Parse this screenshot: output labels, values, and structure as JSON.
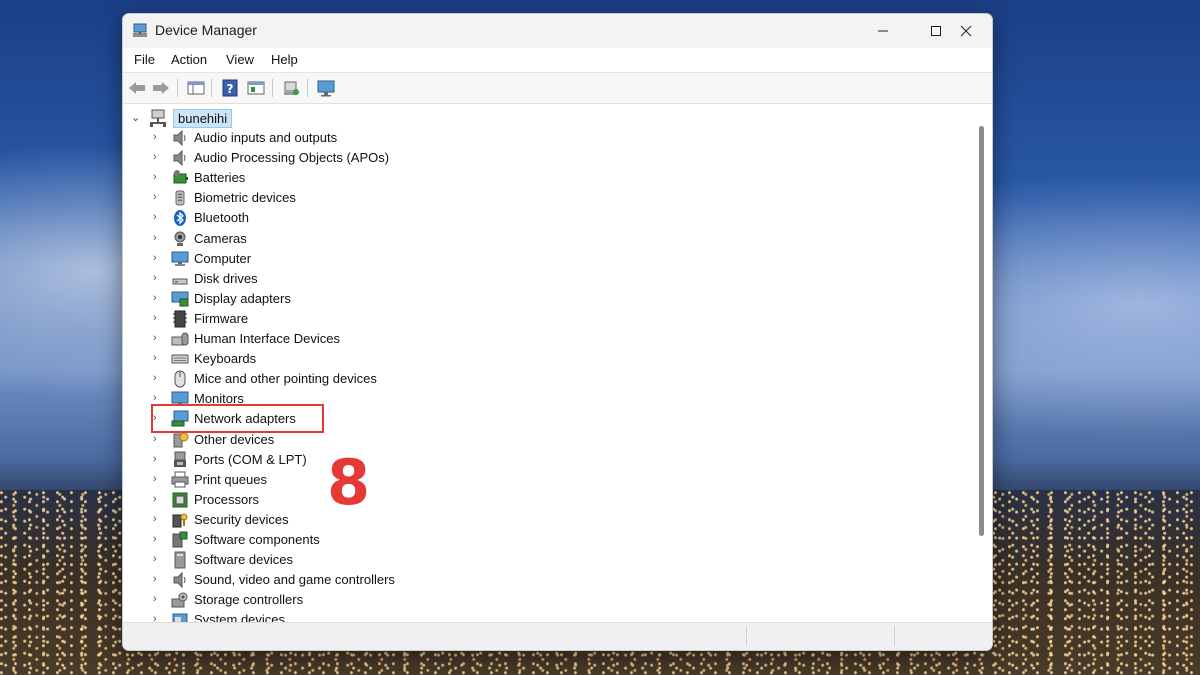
{
  "window": {
    "title": "Device Manager"
  },
  "menu": [
    "File",
    "Action",
    "View",
    "Help"
  ],
  "toolbar": {
    "buttons": [
      "back-arrow-icon",
      "forward-arrow-icon",
      "show-hide-console-tree-icon",
      "help-icon",
      "properties-icon",
      "scan-hardware-changes-icon",
      "monitor-icon"
    ]
  },
  "tree": {
    "root": "bunehihi",
    "categories": [
      {
        "label": "Audio inputs and outputs",
        "icon": "speaker-icon"
      },
      {
        "label": "Audio Processing Objects (APOs)",
        "icon": "speaker-icon"
      },
      {
        "label": "Batteries",
        "icon": "battery-icon"
      },
      {
        "label": "Biometric devices",
        "icon": "biometric-icon"
      },
      {
        "label": "Bluetooth",
        "icon": "bluetooth-icon"
      },
      {
        "label": "Cameras",
        "icon": "camera-icon"
      },
      {
        "label": "Computer",
        "icon": "computer-icon"
      },
      {
        "label": "Disk drives",
        "icon": "disk-drive-icon"
      },
      {
        "label": "Display adapters",
        "icon": "display-adapter-icon"
      },
      {
        "label": "Firmware",
        "icon": "firmware-icon"
      },
      {
        "label": "Human Interface Devices",
        "icon": "hid-icon"
      },
      {
        "label": "Keyboards",
        "icon": "keyboard-icon"
      },
      {
        "label": "Mice and other pointing devices",
        "icon": "mouse-icon"
      },
      {
        "label": "Monitors",
        "icon": "monitor-icon"
      },
      {
        "label": "Network adapters",
        "icon": "network-adapter-icon"
      },
      {
        "label": "Other devices",
        "icon": "other-device-icon"
      },
      {
        "label": "Ports (COM & LPT)",
        "icon": "port-icon"
      },
      {
        "label": "Print queues",
        "icon": "printer-icon"
      },
      {
        "label": "Processors",
        "icon": "processor-icon"
      },
      {
        "label": "Security devices",
        "icon": "security-device-icon"
      },
      {
        "label": "Software components",
        "icon": "software-component-icon"
      },
      {
        "label": "Software devices",
        "icon": "software-device-icon"
      },
      {
        "label": "Sound, video and game controllers",
        "icon": "sound-icon"
      },
      {
        "label": "Storage controllers",
        "icon": "storage-controller-icon"
      },
      {
        "label": "System devices",
        "icon": "system-device-icon"
      }
    ]
  },
  "annotation": {
    "step": "8",
    "highlighted_item": "Network adapters",
    "color": "#e53935"
  }
}
